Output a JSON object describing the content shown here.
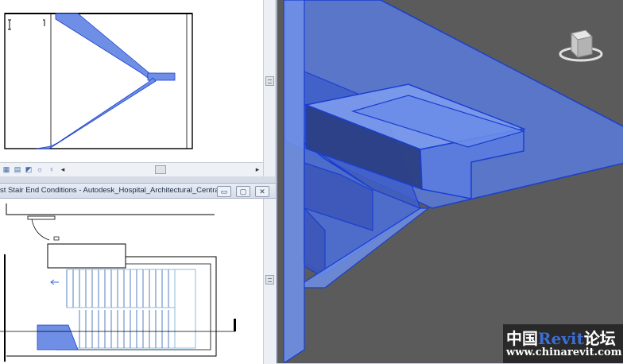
{
  "bottom_window": {
    "title": "st Stair End Conditions - Autodesk_Hospital_Architectural_Central",
    "minimize_glyph": "▭",
    "restore_glyph": "▢",
    "close_glyph": "✕"
  },
  "view_bar_top": {
    "icons": [
      "scale-icon",
      "detail-level-icon",
      "visual-style-icon",
      "sun-path-icon",
      "shadows-icon"
    ],
    "scroll_left_glyph": "◂",
    "scroll_right_glyph": "▸"
  },
  "viewcube": {
    "label": "",
    "icon": "viewcube-icon"
  },
  "watermark": {
    "line1_cn_a": "中国",
    "line1_brand": "Revit",
    "line1_cn_b": "论坛",
    "line2": "www.chinarevit.com"
  },
  "colors": {
    "stair_blue": "#6f8fe6",
    "stair_edge": "#1a3fd0",
    "viewport_bg": "#5b5b5b",
    "plan_line": "#000000"
  }
}
